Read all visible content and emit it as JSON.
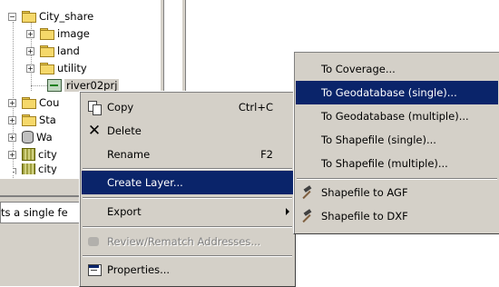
{
  "tree": {
    "items": [
      {
        "label": "City_share",
        "expander": "−"
      },
      {
        "label": "image",
        "expander": "+"
      },
      {
        "label": "land",
        "expander": "+"
      },
      {
        "label": "utility",
        "expander": "+"
      },
      {
        "label": "river02prj",
        "expander": ""
      },
      {
        "label": "Cou",
        "expander": "+"
      },
      {
        "label": "Sta",
        "expander": "+"
      },
      {
        "label": "Wa",
        "expander": "+"
      },
      {
        "label": "city",
        "expander": "+"
      },
      {
        "label": "city",
        "expander": "+"
      }
    ],
    "status_text": "ts a single fe"
  },
  "context_menu": {
    "copy": "Copy",
    "copy_shortcut": "Ctrl+C",
    "delete": "Delete",
    "rename": "Rename",
    "rename_shortcut": "F2",
    "create_layer": "Create Layer...",
    "export": "Export",
    "review": "Review/Rematch Addresses...",
    "properties": "Properties..."
  },
  "submenu": {
    "items": [
      "To Coverage...",
      "To Geodatabase (single)...",
      "To Geodatabase (multiple)...",
      "To Shapefile (single)...",
      "To Shapefile (multiple)...",
      "Shapefile to AGF",
      "Shapefile to DXF"
    ]
  },
  "colors": {
    "highlight": "#0a246a",
    "menu_bg": "#d4d0c8"
  }
}
